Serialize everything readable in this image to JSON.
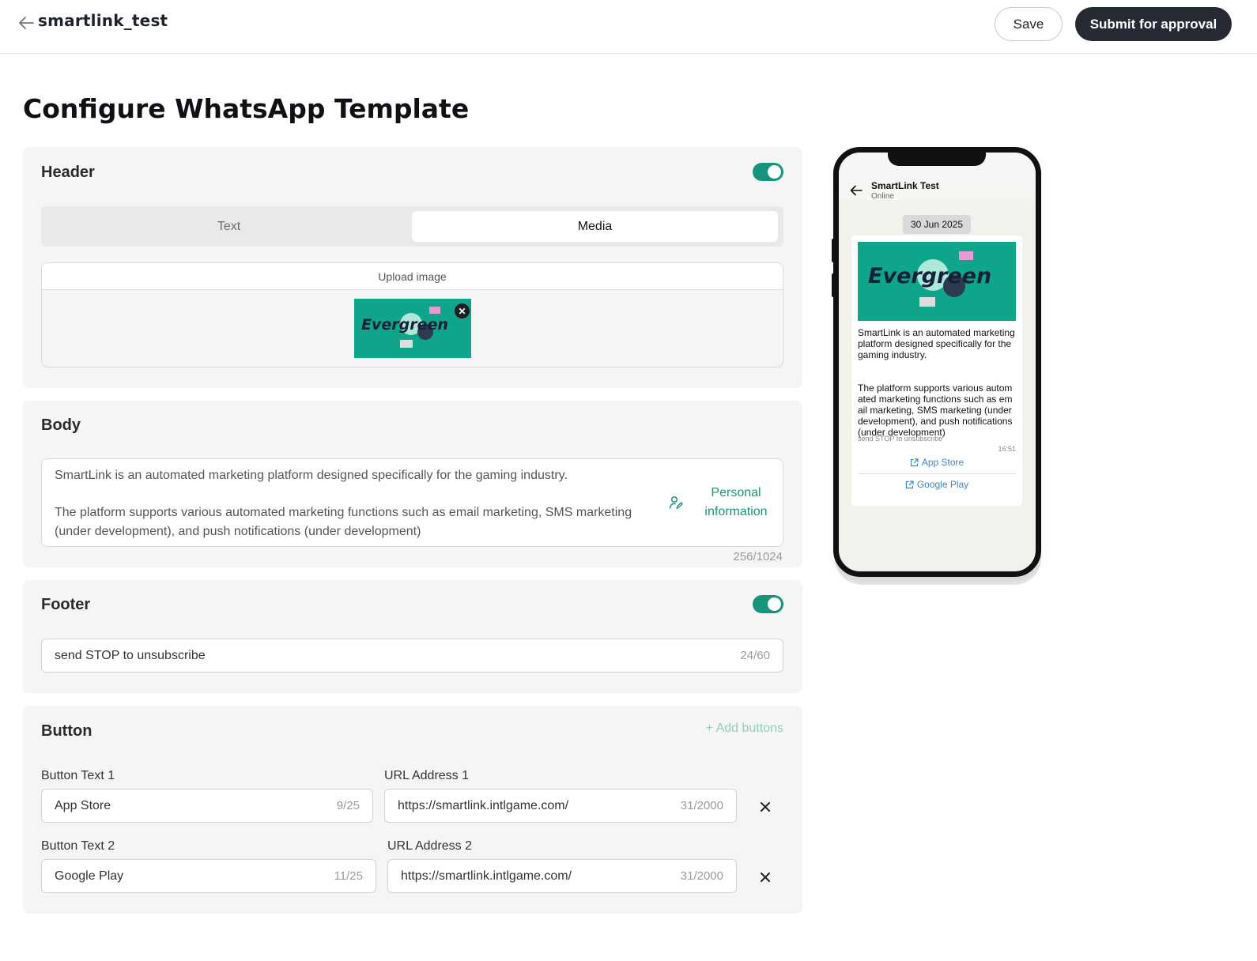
{
  "topbar": {
    "title": "smartlink_test",
    "save_label": "Save",
    "submit_label": "Submit for approval"
  },
  "page": {
    "title": "Configure WhatsApp Template"
  },
  "header_section": {
    "title": "Header",
    "enabled": true,
    "tabs": [
      "Text",
      "Media"
    ],
    "selected_tab": "Media",
    "upload_label": "Upload image",
    "image_text": "Evergreen"
  },
  "body_section": {
    "title": "Body",
    "text": "SmartLink is an automated marketing platform designed specifically for the gaming industry.\n\nThe platform supports various automated marketing functions such as email marketing, SMS marketing (under development), and push notifications (under development)",
    "personal_info_label": "Personal information",
    "counter": "256/1024"
  },
  "footer_section": {
    "title": "Footer",
    "enabled": true,
    "value": "send STOP to unsubscribe",
    "counter": "24/60"
  },
  "button_section": {
    "title": "Button",
    "add_label": "Add buttons",
    "rows": [
      {
        "text_label": "Button Text 1",
        "text_value": "App Store",
        "text_counter": "9/25",
        "url_label": "URL Address 1",
        "url_value": "https://smartlink.intlgame.com/",
        "url_counter": "31/2000"
      },
      {
        "text_label": "Button Text 2",
        "text_value": "Google Play",
        "text_counter": "11/25",
        "url_label": "URL Address 2",
        "url_value": "https://smartlink.intlgame.com/",
        "url_counter": "31/2000"
      }
    ]
  },
  "preview": {
    "contact_name": "SmartLink Test",
    "contact_status": "Online",
    "date": "30 Jun 2025",
    "message_text": "SmartLink is an automated marketing platform designed specifically for the gaming industry.\n\n\nThe platform supports various automated marketing functions such as email marketing, SMS marketing (under development), and push notifications (under development)",
    "footer": "send STOP to unsubscribe",
    "time": "16:51",
    "buttons": [
      "App Store",
      "Google Play"
    ]
  },
  "colors": {
    "accent": "#16957c",
    "dark_button": "#252a35",
    "panel_bg": "#f5f5f6",
    "link_blue": "#3b86c8"
  }
}
